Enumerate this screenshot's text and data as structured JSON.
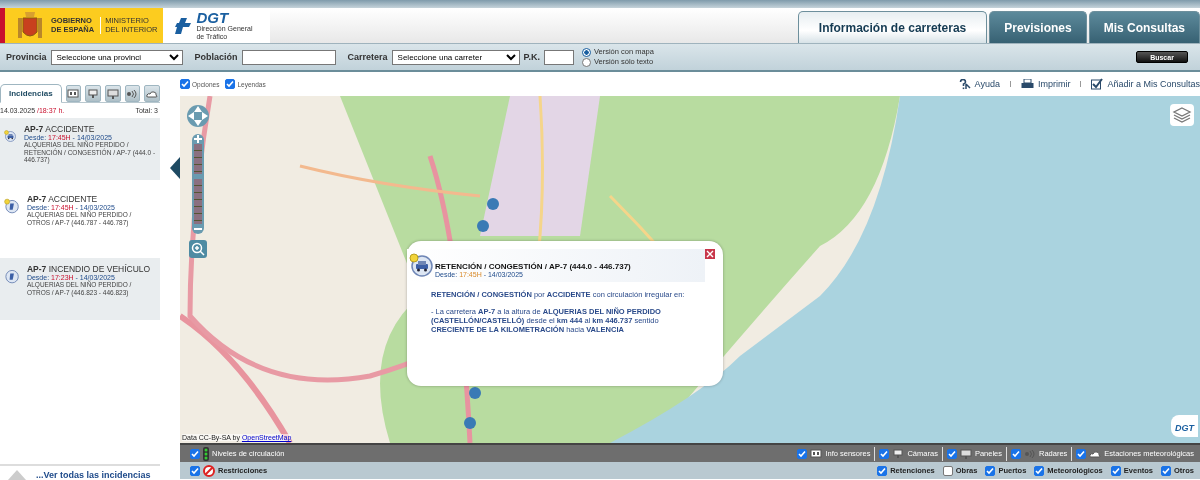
{
  "header": {
    "gov_line_1": "GOBIERNO",
    "gov_line_2": "DE ESPAÑA",
    "ministry_line_1": "MINISTERIO",
    "ministry_line_2": "DEL INTERIOR",
    "dgt_logo": "DGT",
    "dgt_subtitle": "Dirección General de Tráfico"
  },
  "nav_tabs": [
    {
      "label": "Información de carreteras",
      "selected": true
    },
    {
      "label": "Previsiones",
      "selected": false
    },
    {
      "label": "Mis Consultas",
      "selected": false
    }
  ],
  "search": {
    "province_label": "Provincia",
    "province_value": "Seleccione una provinci",
    "town_label": "Población",
    "road_label": "Carretera",
    "road_value": "Seleccione una carreter",
    "pk_label": "P.K.",
    "modes": [
      {
        "label": "Versión con mapa",
        "selected": true
      },
      {
        "label": "Versión sólo texto",
        "selected": false
      }
    ],
    "button": "Buscar"
  },
  "sidebar": {
    "tabs": [
      {
        "kind": "text",
        "label": "Incidencias",
        "selected": true
      },
      {
        "kind": "sensor",
        "selected": false
      },
      {
        "kind": "camera",
        "selected": false
      },
      {
        "kind": "panel",
        "selected": false
      },
      {
        "kind": "radar",
        "selected": false
      },
      {
        "kind": "weather",
        "selected": false
      }
    ],
    "date": "14.03.2025",
    "time": "/18:37 h.",
    "total": "Total: 3",
    "incidents": [
      {
        "kind": "car",
        "badge": true,
        "road": "AP-7",
        "type": "ACCIDENTE",
        "since": "Desde:",
        "time": "17:45H",
        "date": "- 14/03/2025",
        "detail": "ALQUERIAS DEL NIÑO PERDIDO / RETENCIÓN / CONGESTIÓN / AP-7 (444.0 - 446.737)"
      },
      {
        "kind": "other",
        "badge": true,
        "road": "AP-7",
        "type": "ACCIDENTE",
        "since": "Desde:",
        "time": "17:45H",
        "date": "- 14/03/2025",
        "detail": "ALQUERIAS DEL NIÑO PERDIDO / OTROS / AP-7 (446.787 - 446.787)"
      },
      {
        "kind": "other",
        "badge": false,
        "road": "AP-7",
        "type": "INCENDIO DE VEHÍCULO",
        "since": "Desde:",
        "time": "17:23H",
        "date": "- 14/03/2025",
        "detail": "ALQUERIAS DEL NIÑO PERDIDO / OTROS / AP-7 (446.823 - 446.823)"
      }
    ],
    "see_all": "...Ver todas las incidencias"
  },
  "map_options": [
    {
      "label": "Opciones",
      "checked": true
    },
    {
      "label": "Leyendas",
      "checked": true
    }
  ],
  "map_links": [
    {
      "kind": "help",
      "label": "Ayuda"
    },
    {
      "kind": "print",
      "label": "Imprimir"
    },
    {
      "kind": "add",
      "label": "Añadir a Mis Consultas"
    }
  ],
  "map": {
    "attribution": "Data CC-By-SA by",
    "attribution_link": "OpenStreetMap",
    "logo": "DGT",
    "zoom": {
      "level": 0.6
    }
  },
  "popup": {
    "title": "RETENCIÓN / CONGESTIÓN / AP-7 (444.0 - 446.737)",
    "since": "Desde:",
    "time": "17:45H",
    "date": "- 14/03/2025",
    "paragraphs": [
      "**RETENCIÓN / CONGESTIÓN** por **ACCIDENTE** con circulación irregular en:",
      "- La carretera **AP-7** a la altura de **ALQUERIAS DEL NIÑO PERDIDO (CASTELLÓN/CASTELLÓ)** desde el **km 444** al **km 446.737** sentido **CRECIENTE DE LA KILOMETRACIÓN** hacia **VALENCIA**"
    ]
  },
  "layer_bar": {
    "left": [
      {
        "kind": "traffic",
        "label": "Niveles de circulación",
        "checked": true
      }
    ],
    "right": [
      {
        "kind": "sensor",
        "label": "Info sensores",
        "checked": true
      },
      {
        "kind": "camera",
        "label": "Cámaras",
        "checked": true
      },
      {
        "kind": "panel",
        "label": "Paneles",
        "checked": true
      },
      {
        "kind": "radar",
        "label": "Radares",
        "checked": true
      },
      {
        "kind": "weather",
        "label": "Estaciones meteorológicas",
        "checked": true
      }
    ]
  },
  "filter_bar": {
    "left": [
      {
        "kind": "restriction",
        "label": "Restricciones",
        "checked": true
      }
    ],
    "right": [
      {
        "label": "Retenciones",
        "checked": true
      },
      {
        "label": "Obras",
        "checked": false
      },
      {
        "label": "Puertos",
        "checked": true
      },
      {
        "label": "Meteorológicos",
        "checked": true
      },
      {
        "label": "Eventos",
        "checked": true
      },
      {
        "label": "Otros",
        "checked": true
      }
    ]
  }
}
